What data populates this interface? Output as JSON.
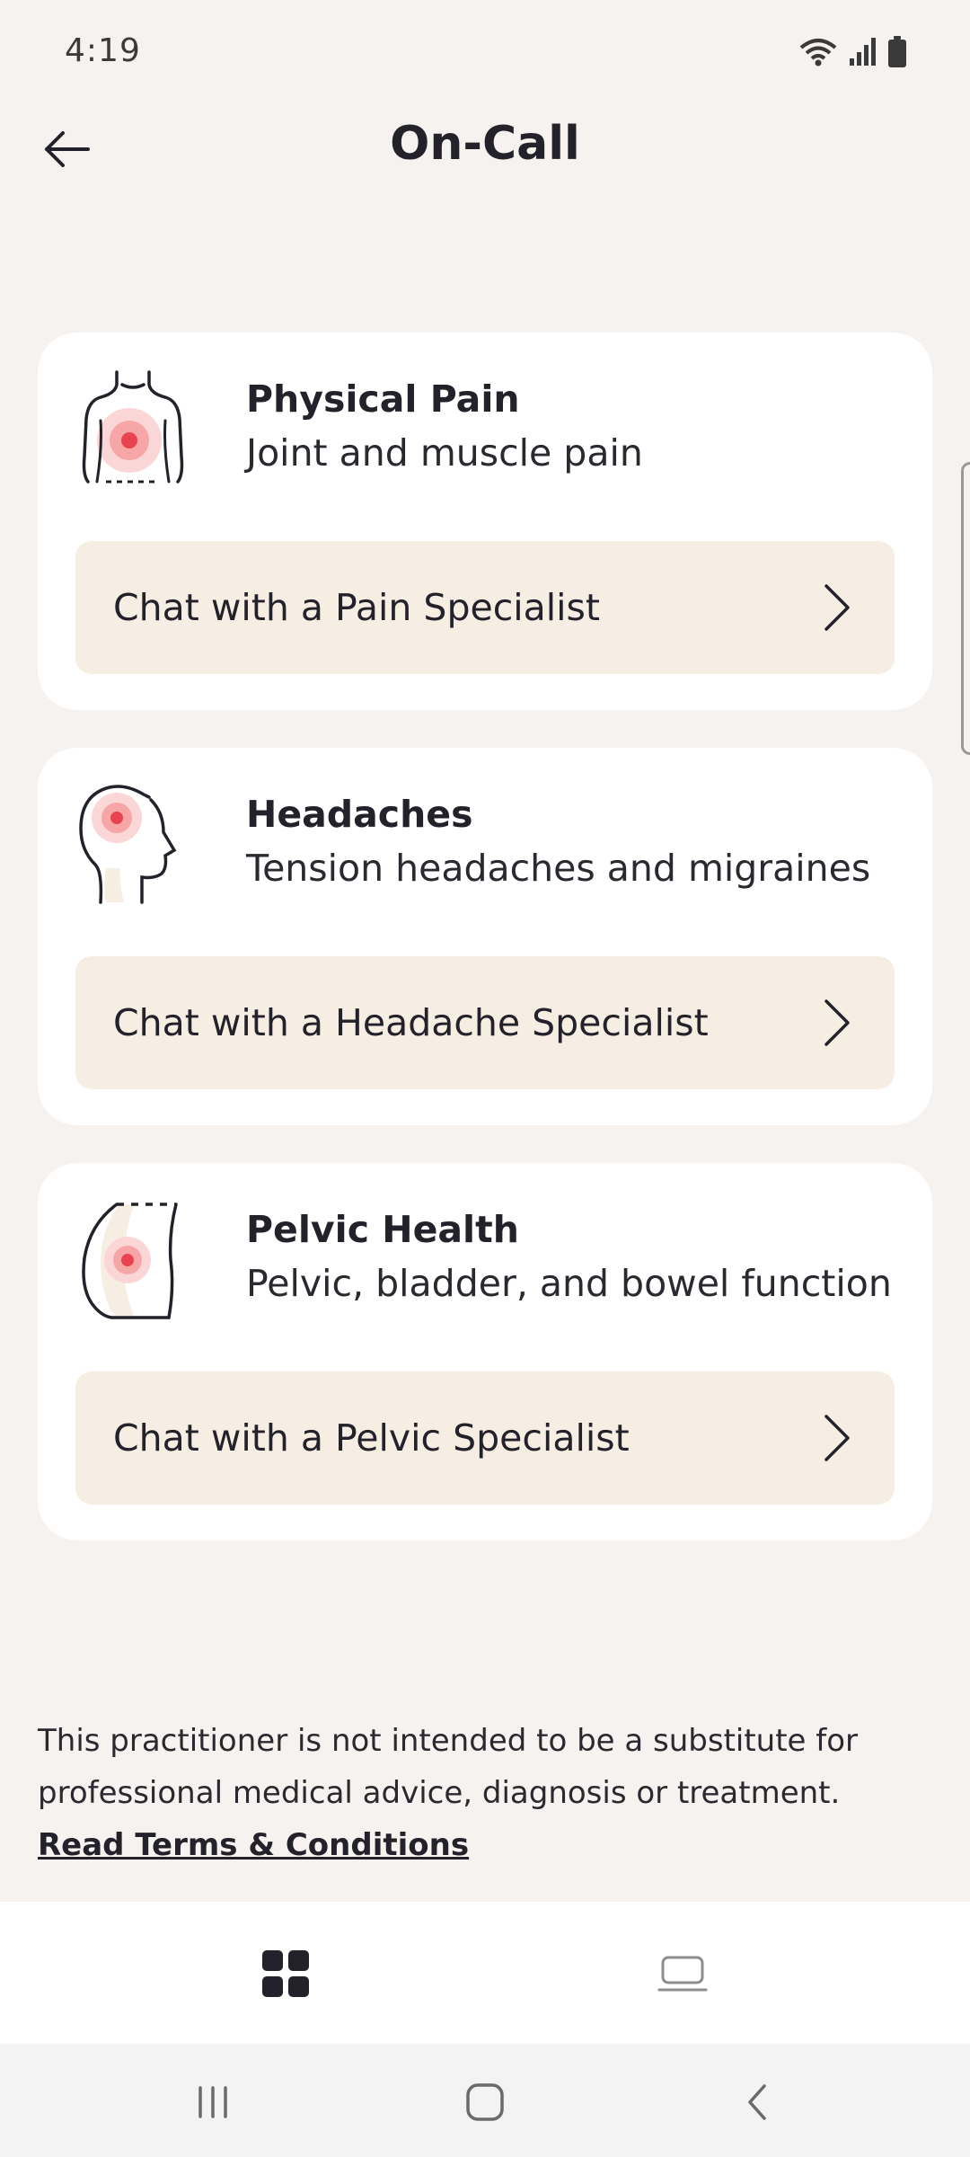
{
  "status_bar": {
    "time": "4:19",
    "icons": [
      "wifi-icon",
      "signal-icon",
      "battery-icon"
    ]
  },
  "header": {
    "title": "On-Call",
    "back_icon": "arrow-left-icon"
  },
  "cards": [
    {
      "title": "Physical Pain",
      "subtitle": "Joint and muscle pain",
      "button_label": "Chat with a Pain Specialist",
      "icon": "torso-pain-icon"
    },
    {
      "title": "Headaches",
      "subtitle": "Tension headaches and migraines",
      "button_label": "Chat with a Headache Specialist",
      "icon": "head-pain-icon"
    },
    {
      "title": "Pelvic Health",
      "subtitle": "Pelvic, bladder, and bowel function",
      "button_label": "Chat with a Pelvic Specialist",
      "icon": "pelvis-pain-icon"
    }
  ],
  "disclaimer": {
    "text": "This practitioner is not intended to be a substitute for professional medical advice, diagnosis or treatment. ",
    "link": "Read Terms & Conditions"
  },
  "tab_bar": {
    "tabs": [
      "grid-icon",
      "laptop-icon"
    ],
    "active": 0
  },
  "system_nav": [
    "recents-icon",
    "home-icon",
    "back-icon"
  ],
  "colors": {
    "background": "#f5f2ef",
    "card": "#ffffff",
    "button": "#f7eee3",
    "text": "#23212a",
    "pain_accent": "#e8434f"
  }
}
